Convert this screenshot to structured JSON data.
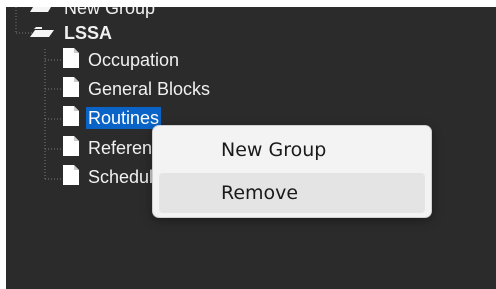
{
  "tree": {
    "nodes": [
      {
        "id": "new-group",
        "label": "New Group",
        "type": "folder-open",
        "bold": false
      },
      {
        "id": "lssa",
        "label": "LSSA",
        "type": "folder-open",
        "bold": true
      },
      {
        "id": "occupation",
        "label": "Occupation",
        "type": "document",
        "bold": false
      },
      {
        "id": "general-blocks",
        "label": "General Blocks",
        "type": "document",
        "bold": false
      },
      {
        "id": "routines",
        "label": "Routines",
        "type": "document",
        "bold": false,
        "selected": true
      },
      {
        "id": "references",
        "label": "References",
        "type": "document",
        "bold": false
      },
      {
        "id": "schedules",
        "label": "Schedules",
        "type": "document",
        "bold": false
      }
    ]
  },
  "context_menu": {
    "items": [
      {
        "label": "New Group",
        "hover": false
      },
      {
        "label": "Remove",
        "hover": true
      }
    ]
  },
  "colors": {
    "background": "#2b2b2b",
    "selection": "#0a64c8",
    "menu_bg": "#f3f3f3",
    "menu_hover": "#e4e4e4"
  }
}
